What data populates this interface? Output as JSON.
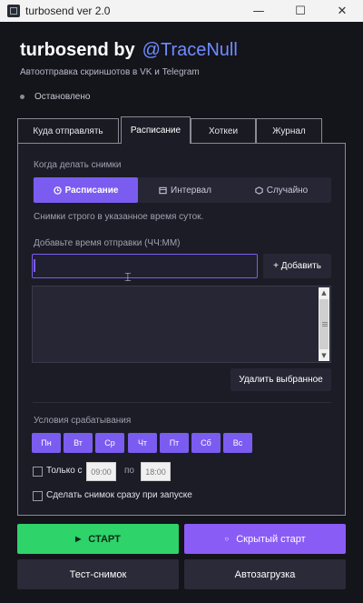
{
  "window": {
    "title": "turbosend ver 2.0",
    "controls": {
      "minimize": "—",
      "maximize": "☐",
      "close": "✕"
    }
  },
  "header": {
    "app_name": "turbosend by",
    "handle": "@TraceNull",
    "subtitle": "Автоотправка скриншотов в VK и Telegram",
    "status": "Остановлено"
  },
  "tabs": [
    {
      "label": "Куда отправлять",
      "active": false
    },
    {
      "label": "Расписание",
      "active": true
    },
    {
      "label": "Хоткеи",
      "active": false
    },
    {
      "label": "Журнал",
      "active": false
    }
  ],
  "schedule": {
    "when_label": "Когда делать снимки",
    "modes": [
      {
        "label": "Расписание",
        "icon": "clock-icon",
        "active": true
      },
      {
        "label": "Интервал",
        "icon": "interval-icon",
        "active": false
      },
      {
        "label": "Случайно",
        "icon": "dice-icon",
        "active": false
      }
    ],
    "mode_description": "Снимки строго в указанное время суток.",
    "time_label": "Добавьте время отправки (ЧЧ:ММ)",
    "time_value": "",
    "add_button": "+ Добавить",
    "times_list": [],
    "delete_button": "Удалить выбранное",
    "conditions_label": "Условия срабатывания",
    "days": [
      "Пн",
      "Вт",
      "Ср",
      "Чт",
      "Пт",
      "Сб",
      "Вс"
    ],
    "only_from_label": "Только с",
    "from_time": "09:00",
    "to_label": "по",
    "to_time": "18:00",
    "only_from_checked": false,
    "snapshot_on_start_label": "Сделать снимок сразу при запуске",
    "snapshot_on_start_checked": false
  },
  "buttons": {
    "start": "СТАРТ",
    "start_icon": "play-icon",
    "hidden_start": "Скрытый старт",
    "hidden_start_icon": "circle-icon",
    "test_shot": "Тест-снимок",
    "autoload": "Автозагрузка"
  },
  "colors": {
    "background": "#14141b",
    "panel": "#1c1c26",
    "accent": "#7b5cf0",
    "handle": "#6f8cff",
    "start_green": "#2ed36a",
    "hidden_purple": "#8a5cf6"
  }
}
